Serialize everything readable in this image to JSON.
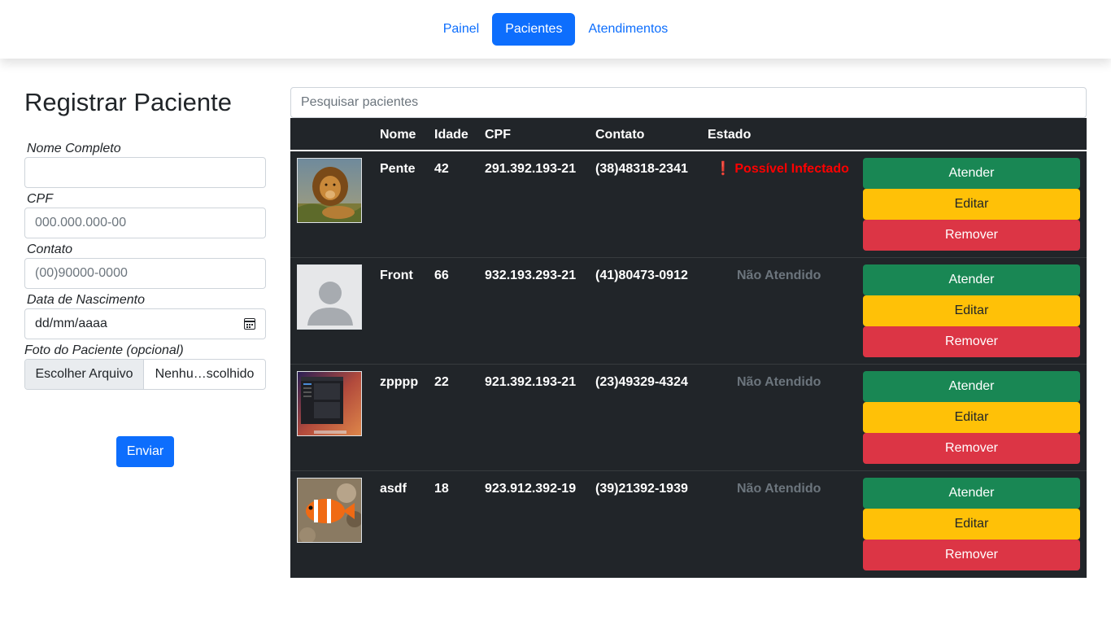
{
  "nav": {
    "items": [
      {
        "label": "Painel"
      },
      {
        "label": "Pacientes"
      },
      {
        "label": "Atendimentos"
      }
    ]
  },
  "form": {
    "title": "Registrar Paciente",
    "name_label": "Nome Completo",
    "name_value": "",
    "cpf_label": "CPF",
    "cpf_placeholder": "000.000.000-00",
    "contact_label": "Contato",
    "contact_placeholder": "(00)90000-0000",
    "birth_label": "Data de Nascimento",
    "birth_value": "dd/mm/aaaa",
    "photo_label": "Foto do Paciente (opcional)",
    "file_button": "Escolher Arquivo",
    "file_name": "Nenhu…scolhido",
    "submit": "Enviar"
  },
  "search": {
    "placeholder": "Pesquisar pacientes"
  },
  "table": {
    "headers": {
      "name": "Nome",
      "age": "Idade",
      "cpf": "CPF",
      "contact": "Contato",
      "state": "Estado"
    },
    "actions": {
      "attend": "Atender",
      "edit": "Editar",
      "remove": "Remover"
    },
    "rows": [
      {
        "name": "Pente",
        "age": "42",
        "cpf": "291.392.193-21",
        "contact": "(38)48318-2341",
        "state": "❗ Possível Infectado",
        "photo": "lion-photo"
      },
      {
        "name": "Front",
        "age": "66",
        "cpf": "932.193.293-21",
        "contact": "(41)80473-0912",
        "state": "Não Atendido",
        "photo": "default-avatar"
      },
      {
        "name": "zpppp",
        "age": "22",
        "cpf": "921.392.193-21",
        "contact": "(23)49329-4324",
        "state": "Não Atendido",
        "photo": "desktop-screenshot"
      },
      {
        "name": "asdf",
        "age": "18",
        "cpf": "923.912.392-19",
        "contact": "(39)21392-1939",
        "state": "Não Atendido",
        "photo": "clownfish-photo"
      }
    ]
  },
  "colors": {
    "primary": "#0d6efd",
    "success": "#198754",
    "warning": "#ffc107",
    "danger": "#dc3545",
    "table_bg": "#212529",
    "infected": "#ff0000",
    "muted": "#6c757d"
  }
}
